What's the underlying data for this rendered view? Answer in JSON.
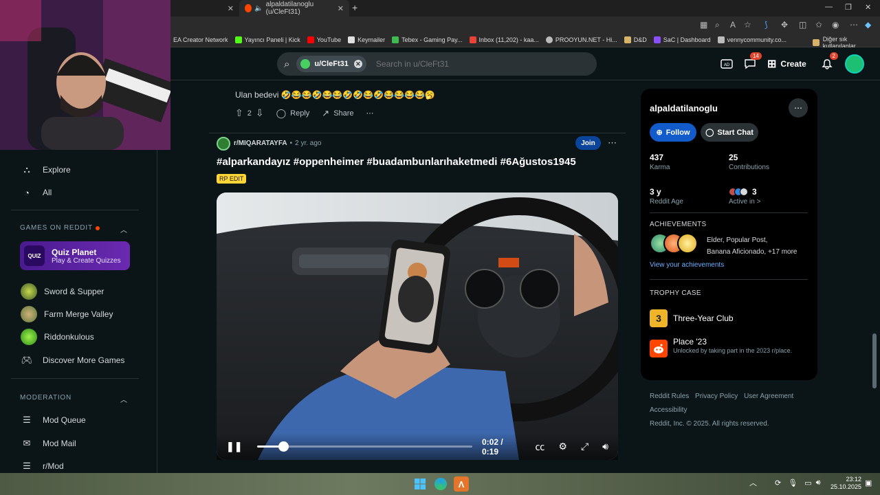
{
  "browser": {
    "tabs": [
      {
        "label": ""
      },
      {
        "label": "alpaldatilanoglu (u/CleFt31)"
      }
    ],
    "bookmarks": [
      {
        "label": "EA Creator Network",
        "color": "#cfcfcf"
      },
      {
        "label": "Yayıncı Paneli | Kick",
        "color": "#53fc18"
      },
      {
        "label": "YouTube",
        "color": "#ff0000"
      },
      {
        "label": "Keymailer",
        "color": "#e0e0e0"
      },
      {
        "label": "Tebex - Gaming Pay...",
        "color": "#3fb950"
      },
      {
        "label": "Inbox (11,202) - kaa...",
        "color": "#ea4335"
      },
      {
        "label": "PROOYUN.NET - Hi...",
        "color": "#bbbbbb"
      },
      {
        "label": "D&D",
        "color": "#d7b36a"
      },
      {
        "label": "SaC | Dashboard",
        "color": "#8a4fff"
      },
      {
        "label": "vennycommunity.co...",
        "color": "#bbbbbb"
      }
    ],
    "other_bookmarks": "Diğer sık kullanılanlar"
  },
  "header": {
    "search_chip": "u/CleFt31",
    "search_placeholder": "Search in u/CleFt31",
    "chat_badge": "14",
    "create_label": "Create",
    "notif_badge": "2"
  },
  "sidebar": {
    "nav": [
      {
        "label": "Explore",
        "icon": "explore-icon"
      },
      {
        "label": "All",
        "icon": "all-icon"
      }
    ],
    "games_title": "GAMES ON REDDIT",
    "quiz": {
      "title": "Quiz Planet",
      "subtitle": "Play & Create Quizzes",
      "logo": "QUIZ"
    },
    "games": [
      {
        "label": "Sword & Supper",
        "color": "#6a8f3a"
      },
      {
        "label": "Farm Merge Valley",
        "color": "#8aa05a"
      },
      {
        "label": "Riddonkulous",
        "color": "#5fbf2a"
      }
    ],
    "discover": "Discover More Games",
    "moderation_title": "MODERATION",
    "moderation": [
      {
        "label": "Mod Queue"
      },
      {
        "label": "Mod Mail"
      },
      {
        "label": "r/Mod"
      }
    ]
  },
  "feed": {
    "comment": {
      "text": "Ulan bedevi 🤣😂😂🤣😂😂🤣🤣😂🤣😂😂😂😂🥱",
      "votes": "2",
      "reply": "Reply",
      "share": "Share"
    },
    "post": {
      "subreddit": "r/MIQARATAYFA",
      "age": "2 yr. ago",
      "join": "Join",
      "title": "#alparkandayız #oppenheimer #buadambunlarıhaketmedi #6Ağustos1945",
      "flair": "RP EDIT",
      "video": {
        "time": "0:02 / 0:19",
        "progress": 0.12
      }
    }
  },
  "profile": {
    "name": "alpaldatilanoglu",
    "follow": "Follow",
    "start_chat": "Start Chat",
    "stats": [
      {
        "value": "437",
        "label": "Karma"
      },
      {
        "value": "25",
        "label": "Contributions"
      },
      {
        "value": "3 y",
        "label": "Reddit Age"
      },
      {
        "value": "3",
        "label": "Active in >"
      }
    ],
    "achievements_title": "ACHIEVEMENTS",
    "achievements_text_1": "Elder, Popular Post,",
    "achievements_text_2": "Banana Aficionado, +17 more",
    "achievements_link": "View your achievements",
    "trophy_title": "TROPHY CASE",
    "trophies": [
      {
        "name": "Three-Year Club",
        "icon": "3",
        "desc": ""
      },
      {
        "name": "Place '23",
        "icon": "",
        "desc": "Unlocked by taking part in the 2023 r/place."
      }
    ]
  },
  "footer": {
    "links": [
      "Reddit Rules",
      "Privacy Policy",
      "User Agreement"
    ],
    "accessibility": "Accessibility",
    "copyright": "Reddit, Inc. © 2025. All rights reserved."
  },
  "taskbar": {
    "time": "23:12",
    "date": "25.10.2025"
  }
}
